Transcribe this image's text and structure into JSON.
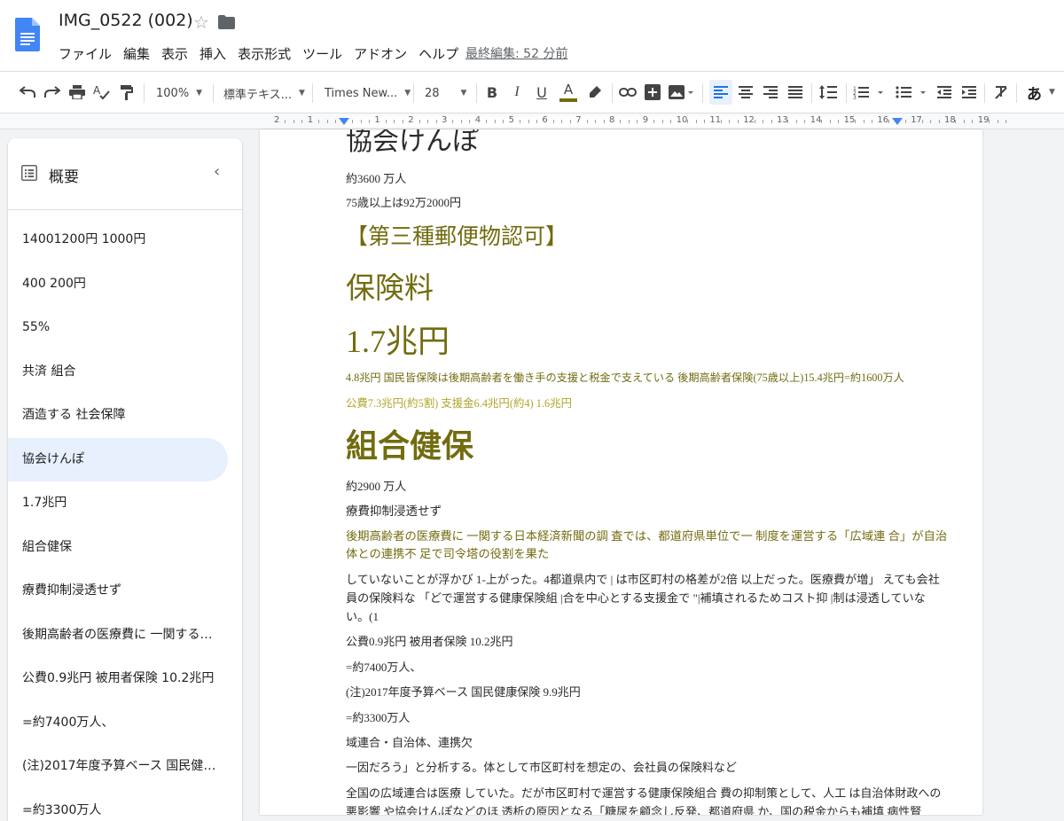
{
  "header": {
    "title": "IMG_0522 (002)",
    "menu": [
      "ファイル",
      "編集",
      "表示",
      "挿入",
      "表示形式",
      "ツール",
      "アドオン",
      "ヘルプ"
    ],
    "last_edit": "最終編集: 52 分前"
  },
  "toolbar": {
    "zoom": "100%",
    "style": "標準テキス...",
    "font": "Times New...",
    "font_size": "28",
    "ime": "あ"
  },
  "ruler": {
    "labels": [
      "2",
      "1",
      "",
      "1",
      "2",
      "3",
      "4",
      "5",
      "6",
      "7",
      "8",
      "9",
      "10",
      "11",
      "12",
      "13",
      "14",
      "15",
      "16",
      "17",
      "18",
      "19"
    ]
  },
  "outline": {
    "title": "概要",
    "items": [
      "14001200円 1000円",
      "400 200円",
      "55%",
      "共済 組合",
      "酒造する 社会保障",
      "協会けんぽ",
      "1.7兆円",
      "組合健保",
      "療費抑制浸透せず",
      "後期高齢者の医療費に 一関する日本経済新聞の調 査",
      "公費0.9兆円 被用者保険 10.2兆円",
      "=約7400万人、",
      "(注)2017年度予算ベース 国民健康保険 9.9兆円",
      "=約3300万人"
    ],
    "active_index": 5
  },
  "document": {
    "lines": [
      "協会けんぽ",
      "約3600 万人",
      "75歳以上は92万2000円",
      "【第三種郵便物認可】",
      "保険料",
      "1.7兆円",
      "4.8兆円 国民皆保険は後期高齢者を働き手の支援と税金で支えている 後期高齢者保険(75歳以上)15.4兆円=約1600万人",
      "公費7.3兆円(約5割) 支援金6.4兆円(約4) 1.6兆円",
      "組合健保",
      "約2900 万人",
      "療費抑制浸透せず",
      "後期高齢者の医療費に 一関する日本経済新聞の調 査では、都道府県単位で一 制度を運営する「広域連 合」が自治",
      "体との連携不 足で司令塔の役割を果た",
      "していないことが浮かび 1-上がった。4都道県内で | は市区町村の格差が2倍 以上だった。医療費が増」 えても会社",
      "員の保険料な 「どで運営する健康保険組 |合を中心とする支援金で \"|補填されるためコスト抑 |制は浸透していな",
      "い。(1",
      "公費0.9兆円 被用者保険 10.2兆円",
      "=約7400万人、",
      "(注)2017年度予算ベース 国民健康保険 9.9兆円",
      "=約3300万人",
      "域連合・自治体、連携欠",
      "一因だろう」と分析する。体として市区町村を想定の、会社員の保険料など",
      "全国の広域連合は医療 していた。だが市区町村で運営する健康保険組合 費の抑制策として、人工 は自治体財政への",
      "悪影響 や協会けんぽなどのほ 透析の原因となる「糖尿を顧念し反発、都道府県 か、国の税金からも補填 病性腎"
    ]
  },
  "colors": {
    "olive": "#726c10",
    "olive_light": "#b0a52a",
    "accent": "#1a73e8",
    "outline_active_bg": "#e8f0fe"
  }
}
